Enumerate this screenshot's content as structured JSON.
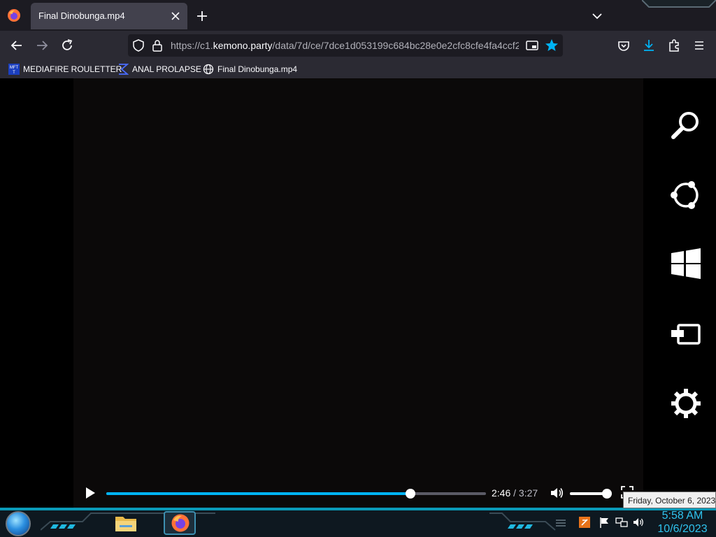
{
  "tab": {
    "title": "Final Dinobunga.mp4"
  },
  "address_bar": {
    "prefix": "https://c1.",
    "host": "kemono.party",
    "path": "/data/7d/ce/7dce1d053199c684bc28e0e2cfc8cfe4fa4ccf2"
  },
  "bookmarks": [
    {
      "label": "MEDIAFIRE ROULETTER",
      "icon": "mediafire-icon"
    },
    {
      "label": "ANAL PROLAPSE",
      "icon": "sum-sigma-icon"
    },
    {
      "label": "Final Dinobunga.mp4",
      "icon": "globe-icon"
    }
  ],
  "player": {
    "current_time": "2:46",
    "separator": "/",
    "duration": "3:27",
    "progress_fraction": 0.802,
    "volume_fraction": 0.96
  },
  "charms": [
    "search-icon",
    "share-icon",
    "windows-start-icon",
    "devices-icon",
    "settings-gear-icon"
  ],
  "tooltip": {
    "date": "Friday, October 6, 2023"
  },
  "taskbar": {
    "apps": [
      "file-explorer-icon",
      "firefox-icon"
    ],
    "tray": [
      "app-tray-icon",
      "action-center-flag-icon",
      "network-icon",
      "volume-icon"
    ]
  },
  "clock": {
    "time": "5:58 AM",
    "date": "10/6/2023"
  },
  "colors": {
    "accent": "#00b3f4",
    "clock": "#2fc3ee"
  }
}
